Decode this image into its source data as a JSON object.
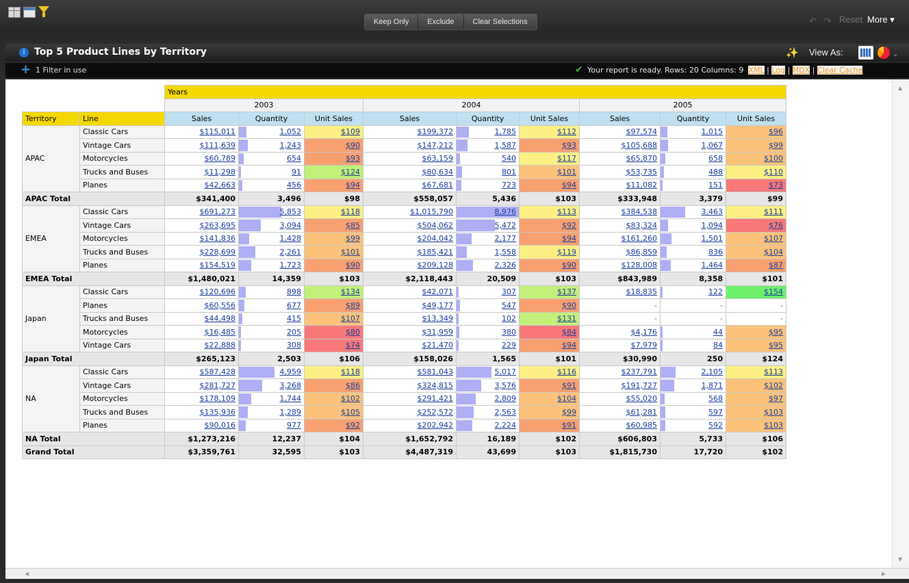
{
  "toolbar": {
    "keep_only": "Keep Only",
    "exclude": "Exclude",
    "clear_selections": "Clear Selections",
    "reset": "Reset",
    "more": "More ▾"
  },
  "report": {
    "title": "Top 5 Product Lines by Territory",
    "view_as": "View As:",
    "filters": "1 Filter in use",
    "status_text": "Your report is ready.  Rows: 20  Columns: 9",
    "links": [
      "XML",
      "Log",
      "MDX",
      "Clear Cache"
    ]
  },
  "pivot": {
    "years_label": "Years",
    "years": [
      "2003",
      "2004",
      "2005"
    ],
    "measures": [
      "Sales",
      "Quantity",
      "Unit Sales"
    ],
    "row_headers": [
      "Territory",
      "Line"
    ],
    "colors": {
      "red": "#f87878",
      "orange": "#f8a070",
      "lightorange": "#fcc27a",
      "yellow": "#fcf083",
      "lime": "#c2f078",
      "green": "#6cf06c",
      "bar": "#aeaef5"
    },
    "territories": [
      {
        "name": "APAC",
        "rows": [
          {
            "line": "Classic Cars",
            "cells": [
              {
                "s": "$115,011",
                "q": "1,052",
                "qv": 1052,
                "u": "$109",
                "c": "yellow"
              },
              {
                "s": "$199,372",
                "q": "1,785",
                "qv": 1785,
                "u": "$112",
                "c": "yellow"
              },
              {
                "s": "$97,574",
                "q": "1,015",
                "qv": 1015,
                "u": "$96",
                "c": "lightorange"
              }
            ]
          },
          {
            "line": "Vintage Cars",
            "cells": [
              {
                "s": "$111,639",
                "q": "1,243",
                "qv": 1243,
                "u": "$90",
                "c": "orange"
              },
              {
                "s": "$147,212",
                "q": "1,587",
                "qv": 1587,
                "u": "$93",
                "c": "orange"
              },
              {
                "s": "$105,688",
                "q": "1,067",
                "qv": 1067,
                "u": "$99",
                "c": "lightorange"
              }
            ]
          },
          {
            "line": "Motorcycles",
            "cells": [
              {
                "s": "$60,789",
                "q": "654",
                "qv": 654,
                "u": "$93",
                "c": "orange"
              },
              {
                "s": "$63,159",
                "q": "540",
                "qv": 540,
                "u": "$117",
                "c": "yellow"
              },
              {
                "s": "$65,870",
                "q": "658",
                "qv": 658,
                "u": "$100",
                "c": "lightorange"
              }
            ]
          },
          {
            "line": "Trucks and Buses",
            "cells": [
              {
                "s": "$11,298",
                "q": "91",
                "qv": 91,
                "u": "$124",
                "c": "lime"
              },
              {
                "s": "$80,634",
                "q": "801",
                "qv": 801,
                "u": "$101",
                "c": "lightorange"
              },
              {
                "s": "$53,735",
                "q": "488",
                "qv": 488,
                "u": "$110",
                "c": "yellow"
              }
            ]
          },
          {
            "line": "Planes",
            "cells": [
              {
                "s": "$42,663",
                "q": "456",
                "qv": 456,
                "u": "$94",
                "c": "orange"
              },
              {
                "s": "$67,681",
                "q": "723",
                "qv": 723,
                "u": "$94",
                "c": "orange"
              },
              {
                "s": "$11,082",
                "q": "151",
                "qv": 151,
                "u": "$73",
                "c": "red"
              }
            ]
          }
        ],
        "total_label": "APAC Total",
        "total": [
          {
            "s": "$341,400",
            "q": "3,496",
            "u": "$98"
          },
          {
            "s": "$558,057",
            "q": "5,436",
            "u": "$103"
          },
          {
            "s": "$333,948",
            "q": "3,379",
            "u": "$99"
          }
        ]
      },
      {
        "name": "EMEA",
        "rows": [
          {
            "line": "Classic Cars",
            "cells": [
              {
                "s": "$691,273",
                "q": "5,853",
                "qv": 5853,
                "u": "$118",
                "c": "yellow"
              },
              {
                "s": "$1,015,790",
                "q": "8,976",
                "qv": 8976,
                "u": "$113",
                "c": "yellow"
              },
              {
                "s": "$384,538",
                "q": "3,463",
                "qv": 3463,
                "u": "$111",
                "c": "yellow"
              }
            ]
          },
          {
            "line": "Vintage Cars",
            "cells": [
              {
                "s": "$263,695",
                "q": "3,094",
                "qv": 3094,
                "u": "$85",
                "c": "orange"
              },
              {
                "s": "$504,062",
                "q": "5,472",
                "qv": 5472,
                "u": "$92",
                "c": "orange"
              },
              {
                "s": "$83,324",
                "q": "1,094",
                "qv": 1094,
                "u": "$76",
                "c": "red"
              }
            ]
          },
          {
            "line": "Motorcycles",
            "cells": [
              {
                "s": "$141,836",
                "q": "1,428",
                "qv": 1428,
                "u": "$99",
                "c": "lightorange"
              },
              {
                "s": "$204,042",
                "q": "2,177",
                "qv": 2177,
                "u": "$94",
                "c": "orange"
              },
              {
                "s": "$161,260",
                "q": "1,501",
                "qv": 1501,
                "u": "$107",
                "c": "lightorange"
              }
            ]
          },
          {
            "line": "Trucks and Buses",
            "cells": [
              {
                "s": "$228,699",
                "q": "2,261",
                "qv": 2261,
                "u": "$101",
                "c": "lightorange"
              },
              {
                "s": "$185,421",
                "q": "1,558",
                "qv": 1558,
                "u": "$119",
                "c": "yellow"
              },
              {
                "s": "$86,859",
                "q": "836",
                "qv": 836,
                "u": "$104",
                "c": "lightorange"
              }
            ]
          },
          {
            "line": "Planes",
            "cells": [
              {
                "s": "$154,519",
                "q": "1,723",
                "qv": 1723,
                "u": "$90",
                "c": "orange"
              },
              {
                "s": "$209,128",
                "q": "2,326",
                "qv": 2326,
                "u": "$90",
                "c": "orange"
              },
              {
                "s": "$128,008",
                "q": "1,464",
                "qv": 1464,
                "u": "$87",
                "c": "orange"
              }
            ]
          }
        ],
        "total_label": "EMEA Total",
        "total": [
          {
            "s": "$1,480,021",
            "q": "14,359",
            "u": "$103"
          },
          {
            "s": "$2,118,443",
            "q": "20,509",
            "u": "$103"
          },
          {
            "s": "$843,989",
            "q": "8,358",
            "u": "$101"
          }
        ]
      },
      {
        "name": "Japan",
        "rows": [
          {
            "line": "Classic Cars",
            "cells": [
              {
                "s": "$120,696",
                "q": "898",
                "qv": 898,
                "u": "$134",
                "c": "lime"
              },
              {
                "s": "$42,071",
                "q": "307",
                "qv": 307,
                "u": "$137",
                "c": "lime"
              },
              {
                "s": "$18,835",
                "q": "122",
                "qv": 122,
                "u": "$154",
                "c": "green"
              }
            ]
          },
          {
            "line": "Planes",
            "cells": [
              {
                "s": "$60,556",
                "q": "677",
                "qv": 677,
                "u": "$89",
                "c": "orange"
              },
              {
                "s": "$49,177",
                "q": "547",
                "qv": 547,
                "u": "$90",
                "c": "orange"
              },
              {
                "s": "-",
                "q": "-",
                "qv": 0,
                "u": "-",
                "c": "none"
              }
            ]
          },
          {
            "line": "Trucks and Buses",
            "cells": [
              {
                "s": "$44,498",
                "q": "415",
                "qv": 415,
                "u": "$107",
                "c": "lightorange"
              },
              {
                "s": "$13,349",
                "q": "102",
                "qv": 102,
                "u": "$131",
                "c": "lime"
              },
              {
                "s": "-",
                "q": "-",
                "qv": 0,
                "u": "-",
                "c": "none"
              }
            ]
          },
          {
            "line": "Motorcycles",
            "cells": [
              {
                "s": "$16,485",
                "q": "205",
                "qv": 205,
                "u": "$80",
                "c": "red"
              },
              {
                "s": "$31,959",
                "q": "380",
                "qv": 380,
                "u": "$84",
                "c": "red"
              },
              {
                "s": "$4,176",
                "q": "44",
                "qv": 44,
                "u": "$95",
                "c": "lightorange"
              }
            ]
          },
          {
            "line": "Vintage Cars",
            "cells": [
              {
                "s": "$22,888",
                "q": "308",
                "qv": 308,
                "u": "$74",
                "c": "red"
              },
              {
                "s": "$21,470",
                "q": "229",
                "qv": 229,
                "u": "$94",
                "c": "orange"
              },
              {
                "s": "$7,979",
                "q": "84",
                "qv": 84,
                "u": "$95",
                "c": "lightorange"
              }
            ]
          }
        ],
        "total_label": "Japan Total",
        "total": [
          {
            "s": "$265,123",
            "q": "2,503",
            "u": "$106"
          },
          {
            "s": "$158,026",
            "q": "1,565",
            "u": "$101"
          },
          {
            "s": "$30,990",
            "q": "250",
            "u": "$124"
          }
        ]
      },
      {
        "name": "NA",
        "rows": [
          {
            "line": "Classic Cars",
            "cells": [
              {
                "s": "$587,428",
                "q": "4,959",
                "qv": 4959,
                "u": "$118",
                "c": "yellow"
              },
              {
                "s": "$581,043",
                "q": "5,017",
                "qv": 5017,
                "u": "$116",
                "c": "yellow"
              },
              {
                "s": "$237,791",
                "q": "2,105",
                "qv": 2105,
                "u": "$113",
                "c": "yellow"
              }
            ]
          },
          {
            "line": "Vintage Cars",
            "cells": [
              {
                "s": "$281,727",
                "q": "3,268",
                "qv": 3268,
                "u": "$86",
                "c": "orange"
              },
              {
                "s": "$324,815",
                "q": "3,576",
                "qv": 3576,
                "u": "$91",
                "c": "orange"
              },
              {
                "s": "$191,727",
                "q": "1,871",
                "qv": 1871,
                "u": "$102",
                "c": "lightorange"
              }
            ]
          },
          {
            "line": "Motorcycles",
            "cells": [
              {
                "s": "$178,109",
                "q": "1,744",
                "qv": 1744,
                "u": "$102",
                "c": "lightorange"
              },
              {
                "s": "$291,421",
                "q": "2,809",
                "qv": 2809,
                "u": "$104",
                "c": "lightorange"
              },
              {
                "s": "$55,020",
                "q": "568",
                "qv": 568,
                "u": "$97",
                "c": "lightorange"
              }
            ]
          },
          {
            "line": "Trucks and Buses",
            "cells": [
              {
                "s": "$135,936",
                "q": "1,289",
                "qv": 1289,
                "u": "$105",
                "c": "lightorange"
              },
              {
                "s": "$252,572",
                "q": "2,563",
                "qv": 2563,
                "u": "$99",
                "c": "lightorange"
              },
              {
                "s": "$61,281",
                "q": "597",
                "qv": 597,
                "u": "$103",
                "c": "lightorange"
              }
            ]
          },
          {
            "line": "Planes",
            "cells": [
              {
                "s": "$90,016",
                "q": "977",
                "qv": 977,
                "u": "$92",
                "c": "orange"
              },
              {
                "s": "$202,942",
                "q": "2,224",
                "qv": 2224,
                "u": "$91",
                "c": "orange"
              },
              {
                "s": "$60,985",
                "q": "592",
                "qv": 592,
                "u": "$103",
                "c": "lightorange"
              }
            ]
          }
        ],
        "total_label": "NA Total",
        "total": [
          {
            "s": "$1,273,216",
            "q": "12,237",
            "u": "$104"
          },
          {
            "s": "$1,652,792",
            "q": "16,189",
            "u": "$102"
          },
          {
            "s": "$606,803",
            "q": "5,733",
            "u": "$106"
          }
        ]
      }
    ],
    "grand_total_label": "Grand Total",
    "grand_total": [
      {
        "s": "$3,359,761",
        "q": "32,595",
        "u": "$103"
      },
      {
        "s": "$4,487,319",
        "q": "43,699",
        "u": "$103"
      },
      {
        "s": "$1,815,730",
        "q": "17,720",
        "u": "$102"
      }
    ]
  }
}
